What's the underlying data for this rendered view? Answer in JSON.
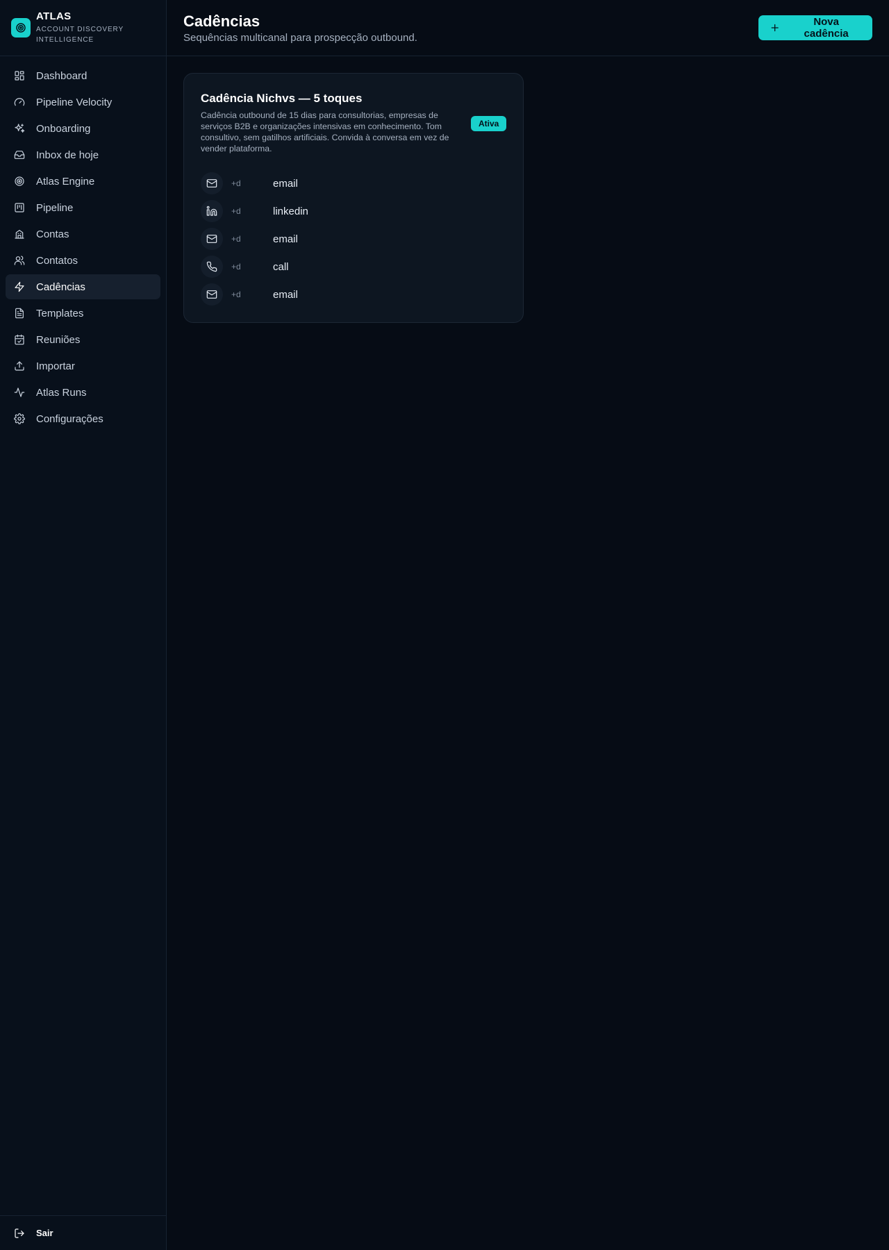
{
  "brand": {
    "name": "ATLAS",
    "subtitle": "ACCOUNT DISCOVERY INTELLIGENCE"
  },
  "sidebar": {
    "items": [
      {
        "label": "Dashboard",
        "icon": "dashboard-icon"
      },
      {
        "label": "Pipeline Velocity",
        "icon": "gauge-icon"
      },
      {
        "label": "Onboarding",
        "icon": "sparkles-icon"
      },
      {
        "label": "Inbox de hoje",
        "icon": "inbox-icon"
      },
      {
        "label": "Atlas Engine",
        "icon": "target-icon"
      },
      {
        "label": "Pipeline",
        "icon": "kanban-icon"
      },
      {
        "label": "Contas",
        "icon": "building-icon"
      },
      {
        "label": "Contatos",
        "icon": "users-icon"
      },
      {
        "label": "Cadências",
        "icon": "zap-icon",
        "active": true
      },
      {
        "label": "Templates",
        "icon": "file-text-icon"
      },
      {
        "label": "Reuniões",
        "icon": "calendar-check-icon"
      },
      {
        "label": "Importar",
        "icon": "upload-icon"
      },
      {
        "label": "Atlas Runs",
        "icon": "activity-icon"
      },
      {
        "label": "Configurações",
        "icon": "gear-icon"
      }
    ],
    "footer_label": "Sair"
  },
  "header": {
    "title": "Cadências",
    "subtitle": "Sequências multicanal para prospecção outbound.",
    "new_button_label": "Nova cadência"
  },
  "cadence": {
    "title": "Cadência Nichvs — 5 toques",
    "description": "Cadência outbound de 15 dias para consultorias, empresas de serviços B2B e organizações intensivas em conhecimento. Tom consultivo, sem gatilhos artificiais. Convida à conversa em vez de vender plataforma.",
    "status": "Ativa",
    "steps": [
      {
        "delay": "+d",
        "channel": "email",
        "icon": "mail-icon"
      },
      {
        "delay": "+d",
        "channel": "linkedin",
        "icon": "linkedin-icon"
      },
      {
        "delay": "+d",
        "channel": "email",
        "icon": "mail-icon"
      },
      {
        "delay": "+d",
        "channel": "call",
        "icon": "phone-icon"
      },
      {
        "delay": "+d",
        "channel": "email",
        "icon": "mail-icon"
      }
    ]
  },
  "colors": {
    "accent": "#19d1cc",
    "background": "#060c15",
    "sidebar": "#08101b",
    "card": "#0d1621"
  }
}
